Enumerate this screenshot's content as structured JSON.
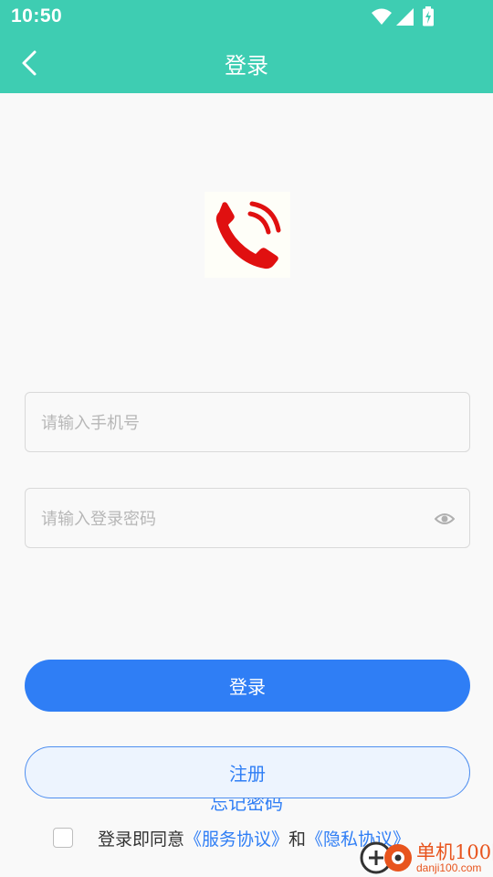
{
  "status_bar": {
    "time": "10:50",
    "icons": [
      "wifi-icon",
      "signal-icon",
      "battery-charging-icon"
    ]
  },
  "header": {
    "title": "登录",
    "back_icon": "chevron-left-icon",
    "background_color": "#3ecdb2"
  },
  "logo": {
    "icon": "phone-call-icon",
    "color": "#e01010"
  },
  "form": {
    "phone_placeholder": "请输入手机号",
    "password_placeholder": "请输入登录密码",
    "password_toggle_icon": "eye-icon"
  },
  "buttons": {
    "login_label": "登录",
    "register_label": "注册",
    "forgot_password": "忘记密码",
    "accent_color": "#2f7ef5"
  },
  "agreement": {
    "prefix": "登录即同意",
    "service_link": "《服务协议》",
    "and": "和",
    "privacy_link": "《隐私协议》",
    "checked": false
  },
  "watermark": {
    "title": "单机100网",
    "url": "danji100.com"
  }
}
